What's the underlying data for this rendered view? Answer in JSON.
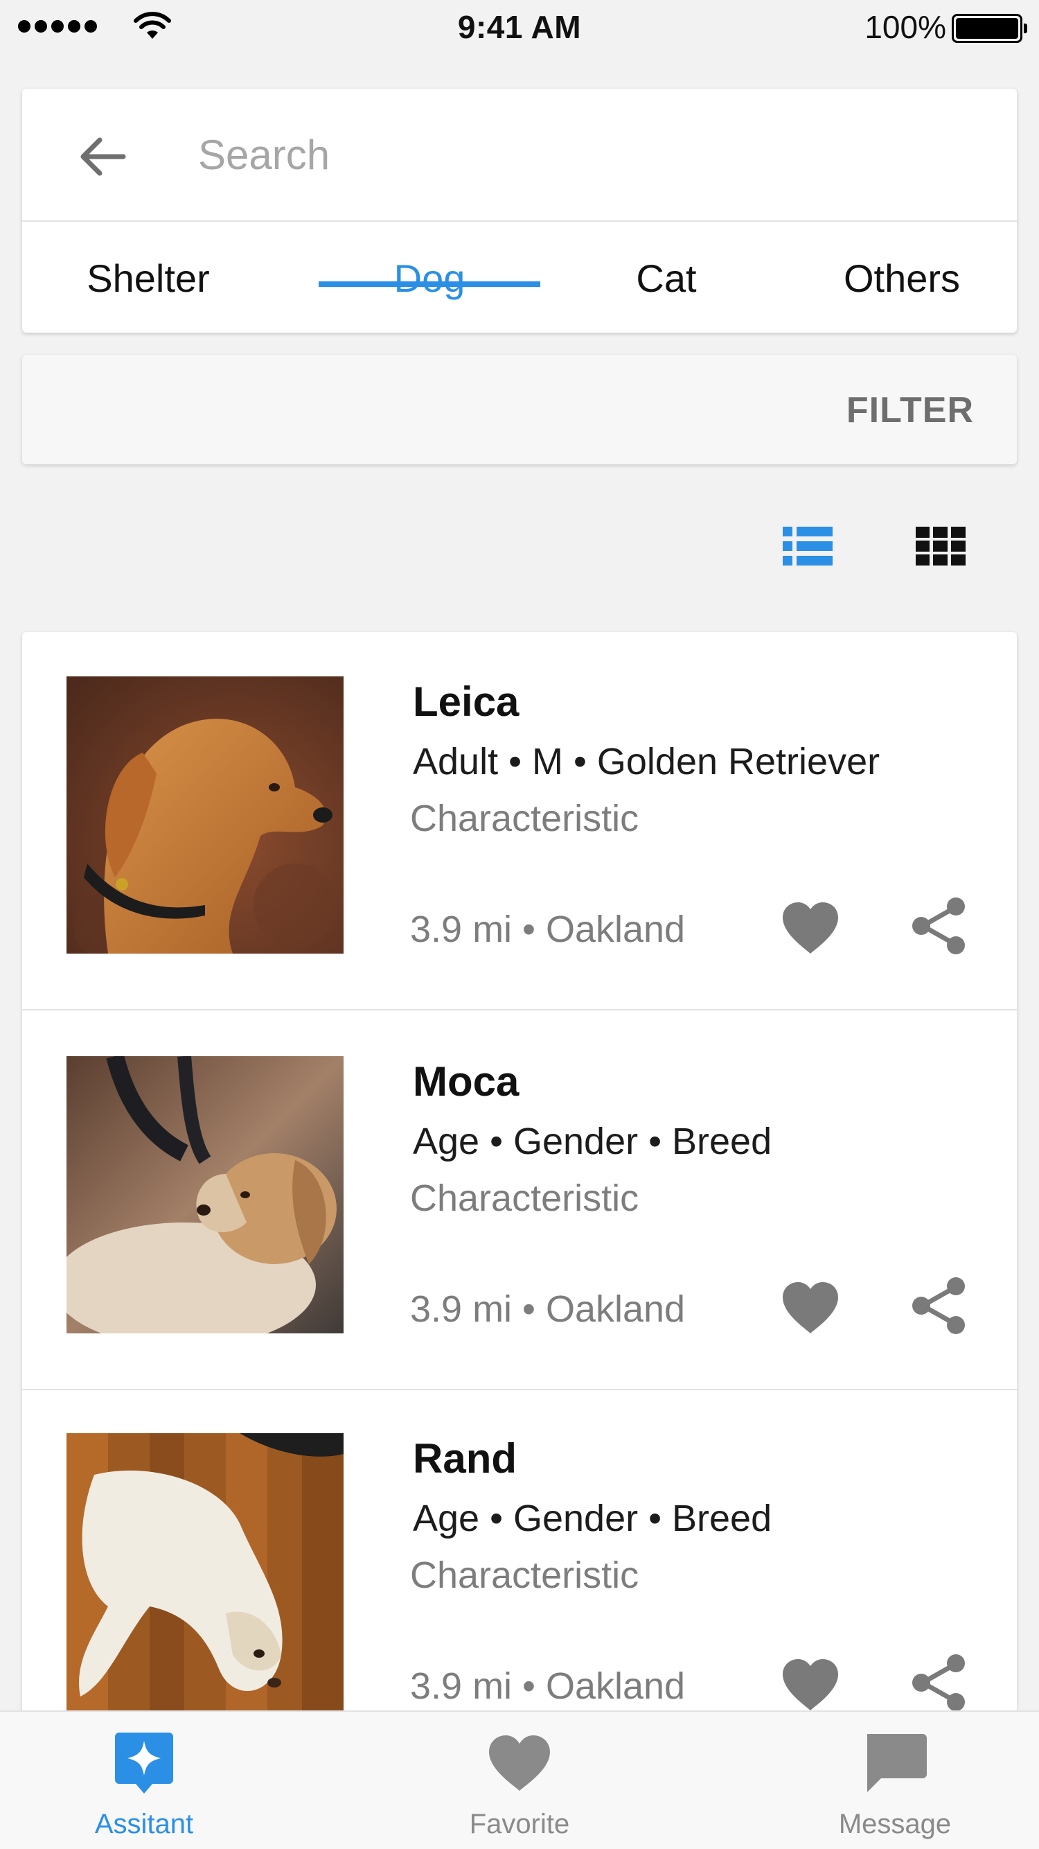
{
  "status_bar": {
    "time": "9:41 AM",
    "battery": "100%"
  },
  "search": {
    "placeholder": "Search",
    "back_icon": "arrow-left-icon"
  },
  "tabs": [
    {
      "label": "Shelter",
      "active": false
    },
    {
      "label": "Dog",
      "active": true
    },
    {
      "label": "Cat",
      "active": false
    },
    {
      "label": "Others",
      "active": false
    }
  ],
  "filter": {
    "label": "FILTER"
  },
  "view_toggle": {
    "list_icon": "list-view-icon",
    "grid_icon": "grid-view-icon",
    "selected": "list"
  },
  "pets": [
    {
      "name": "Leica",
      "info": "Adult • M • Golden Retriever",
      "characteristic": "Characteristic",
      "location": "3.9 mi • Oakland"
    },
    {
      "name": "Moca",
      "info": "Age • Gender • Breed",
      "characteristic": "Characteristic",
      "location": "3.9 mi • Oakland"
    },
    {
      "name": "Rand",
      "info": "Age • Gender • Breed",
      "characteristic": "Characteristic",
      "location": "3.9 mi • Oakland"
    }
  ],
  "bottom_nav": [
    {
      "label": "Assitant",
      "icon": "assistant-sparkle-icon",
      "active": true
    },
    {
      "label": "Favorite",
      "icon": "heart-icon",
      "active": false
    },
    {
      "label": "Message",
      "icon": "message-icon",
      "active": false
    }
  ],
  "colors": {
    "accent": "#2b8fe6",
    "background": "#f2f2f2",
    "icon_gray": "#7a7a7a"
  }
}
